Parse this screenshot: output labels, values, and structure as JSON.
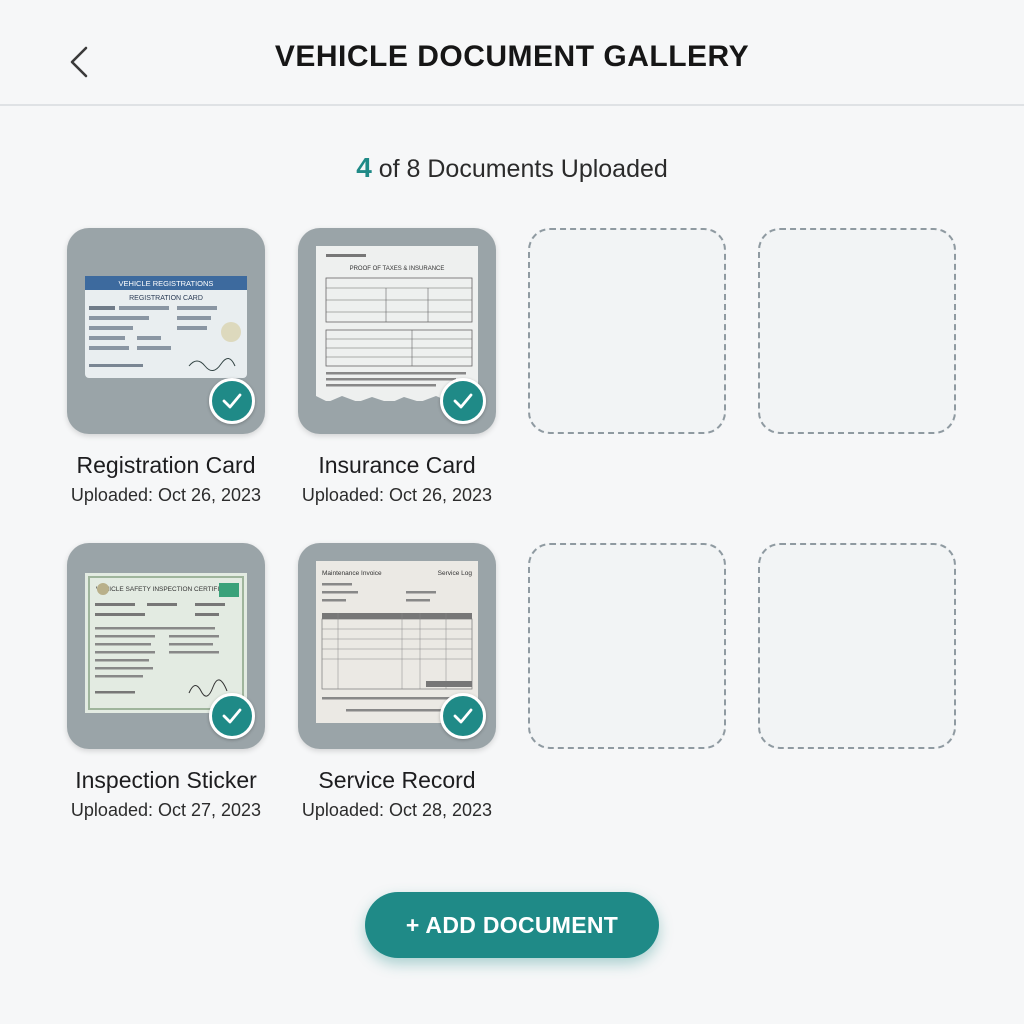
{
  "header": {
    "title": "VEHICLE DOCUMENT GALLERY",
    "back_icon": "chevron-left-icon"
  },
  "progress": {
    "count": "4",
    "text": " of 8 Documents Uploaded"
  },
  "documents": [
    {
      "name": "Registration Card",
      "uploaded": "Uploaded: Oct 26, 2023",
      "status": "uploaded"
    },
    {
      "name": "Insurance Card",
      "uploaded": "Uploaded: Oct 26, 2023",
      "status": "uploaded"
    },
    {
      "name": "Inspection Sticker",
      "uploaded": "Uploaded: Oct 27, 2023",
      "status": "uploaded"
    },
    {
      "name": "Service Record",
      "uploaded": "Uploaded: Oct 28, 2023",
      "status": "uploaded"
    }
  ],
  "doc_text": {
    "registration_header": "VEHICLE REGISTRATIONS",
    "registration_title": "REGISTRATION CARD",
    "insurance_title": "PROOF OF TAXES & INSURANCE",
    "inspection_title": "VEHICLE SAFETY INSPECTION CERTIFICATE",
    "service_left": "Maintenance Invoice",
    "service_right": "Service Log"
  },
  "empty_slots": 4,
  "actions": {
    "add_label": "+ ADD DOCUMENT"
  },
  "colors": {
    "accent": "#1f8a87",
    "tile_bg": "#9aa4a8",
    "page_bg": "#f6f7f8"
  }
}
